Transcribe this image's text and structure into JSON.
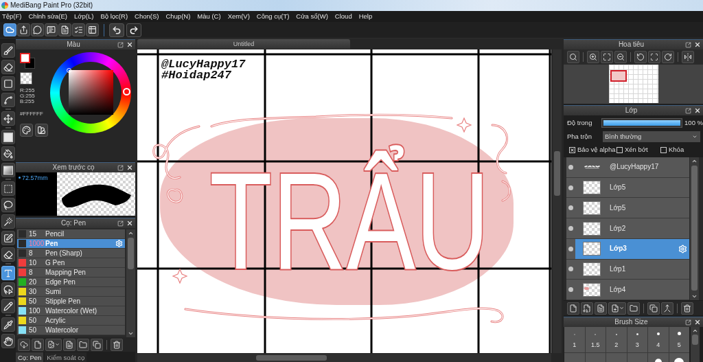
{
  "window": {
    "title": "MediBang Paint Pro (32bit)"
  },
  "menu": [
    "Tệp(F)",
    "Chỉnh sửa(E)",
    "Lớp(L)",
    "Bộ lọc(R)",
    "Chon(S)",
    "Chup(N)",
    "Màu (C)",
    "Xem(V)",
    "Công cụ(T)",
    "Cửa sổ(W)",
    "Cloud",
    "Help"
  ],
  "tool_groups": [
    [
      {
        "kind": "brush",
        "selected": false
      },
      {
        "kind": "eraser",
        "selected": false
      },
      {
        "kind": "shape",
        "selected": false
      },
      {
        "kind": "curve",
        "selected": false
      }
    ],
    [
      {
        "kind": "move",
        "selected": false
      }
    ],
    [
      {
        "kind": "fill",
        "selected": false
      },
      {
        "kind": "bucket",
        "selected": false
      },
      {
        "kind": "gradient",
        "selected": false
      }
    ],
    [
      {
        "kind": "select",
        "selected": false
      },
      {
        "kind": "lasso",
        "selected": false
      },
      {
        "kind": "wand",
        "selected": false
      },
      {
        "kind": "select_pen",
        "selected": false
      },
      {
        "kind": "select_eraser",
        "selected": false
      }
    ],
    [
      {
        "kind": "text",
        "selected": true
      },
      {
        "kind": "operation",
        "selected": false
      },
      {
        "kind": "divide",
        "selected": false
      }
    ],
    [
      {
        "kind": "eyedropper",
        "selected": false
      },
      {
        "kind": "hand",
        "selected": false
      }
    ]
  ],
  "color_panel": {
    "title": "Màu",
    "rgb": [
      "R:255",
      "G:255",
      "B:255"
    ],
    "hex": "#FFFFFF"
  },
  "brush_preview": {
    "title": "Xem trước cọ",
    "size": "72.57mm"
  },
  "brush_panel": {
    "title": "Cọ: Pen",
    "brushes": [
      {
        "size": "15",
        "name": "Pencil",
        "color": "#2b2b2b",
        "selected": false
      },
      {
        "size": "1000",
        "name": "Pen",
        "color": "#2b2b2b",
        "selected": true
      },
      {
        "size": "8",
        "name": "Pen (Sharp)",
        "color": "#2b2b2b",
        "selected": false
      },
      {
        "size": "10",
        "name": "G Pen",
        "color": "#f03c3c",
        "selected": false
      },
      {
        "size": "8",
        "name": "Mapping Pen",
        "color": "#f03c3c",
        "selected": false
      },
      {
        "size": "20",
        "name": "Edge Pen",
        "color": "#22b022",
        "selected": false
      },
      {
        "size": "30",
        "name": "Sumi",
        "color": "#ecd81c",
        "selected": false
      },
      {
        "size": "50",
        "name": "Stipple Pen",
        "color": "#ecd81c",
        "selected": false
      },
      {
        "size": "100",
        "name": "Watercolor (Wet)",
        "color": "#86e0f5",
        "selected": false
      },
      {
        "size": "50",
        "name": "Acrylic",
        "color": "#ecd81c",
        "selected": false
      },
      {
        "size": "50",
        "name": "Watercolor",
        "color": "#86e0f5",
        "selected": false
      }
    ],
    "tabs": [
      {
        "label": "Cọ: Pen",
        "selected": true
      },
      {
        "label": "Kiểm soát cọ",
        "selected": false
      }
    ]
  },
  "canvas": {
    "tab": "Untitled",
    "signature": [
      "@LucyHappy17",
      "#Hoidap247"
    ],
    "lettering": "TRẨU"
  },
  "navigator": {
    "title": "Hoa tiêu"
  },
  "layers": {
    "title": "Lớp",
    "opacity_label": "Độ trong",
    "opacity": {
      "level": 1.0
    },
    "opacity_reading": "100 %",
    "blend_label": "Pha trộn",
    "blend_mode": "Bình thường",
    "options": [
      {
        "label": "Bảo vệ alpha",
        "checked": true
      },
      {
        "label": "Xén bớt",
        "checked": false
      },
      {
        "label": "Khóa",
        "checked": false
      }
    ],
    "items": [
      {
        "name": "@LucyHappy17",
        "kind": "text",
        "visible": true,
        "selected": false
      },
      {
        "name": "Lớp5",
        "kind": "blank",
        "visible": true,
        "selected": false
      },
      {
        "name": "Lớp5",
        "kind": "blank",
        "visible": true,
        "selected": false
      },
      {
        "name": "Lớp2",
        "kind": "blank",
        "visible": true,
        "selected": false
      },
      {
        "name": "Lớp3",
        "kind": "blank",
        "visible": true,
        "selected": true
      },
      {
        "name": "Lớp1",
        "kind": "blank",
        "visible": true,
        "selected": false
      },
      {
        "name": "Lớp4",
        "kind": "sketch",
        "visible": true,
        "selected": false
      }
    ]
  },
  "brush_size": {
    "title": "Brush Size",
    "sizes": [
      "1",
      "1.5",
      "2",
      "3",
      "4",
      "5"
    ]
  }
}
